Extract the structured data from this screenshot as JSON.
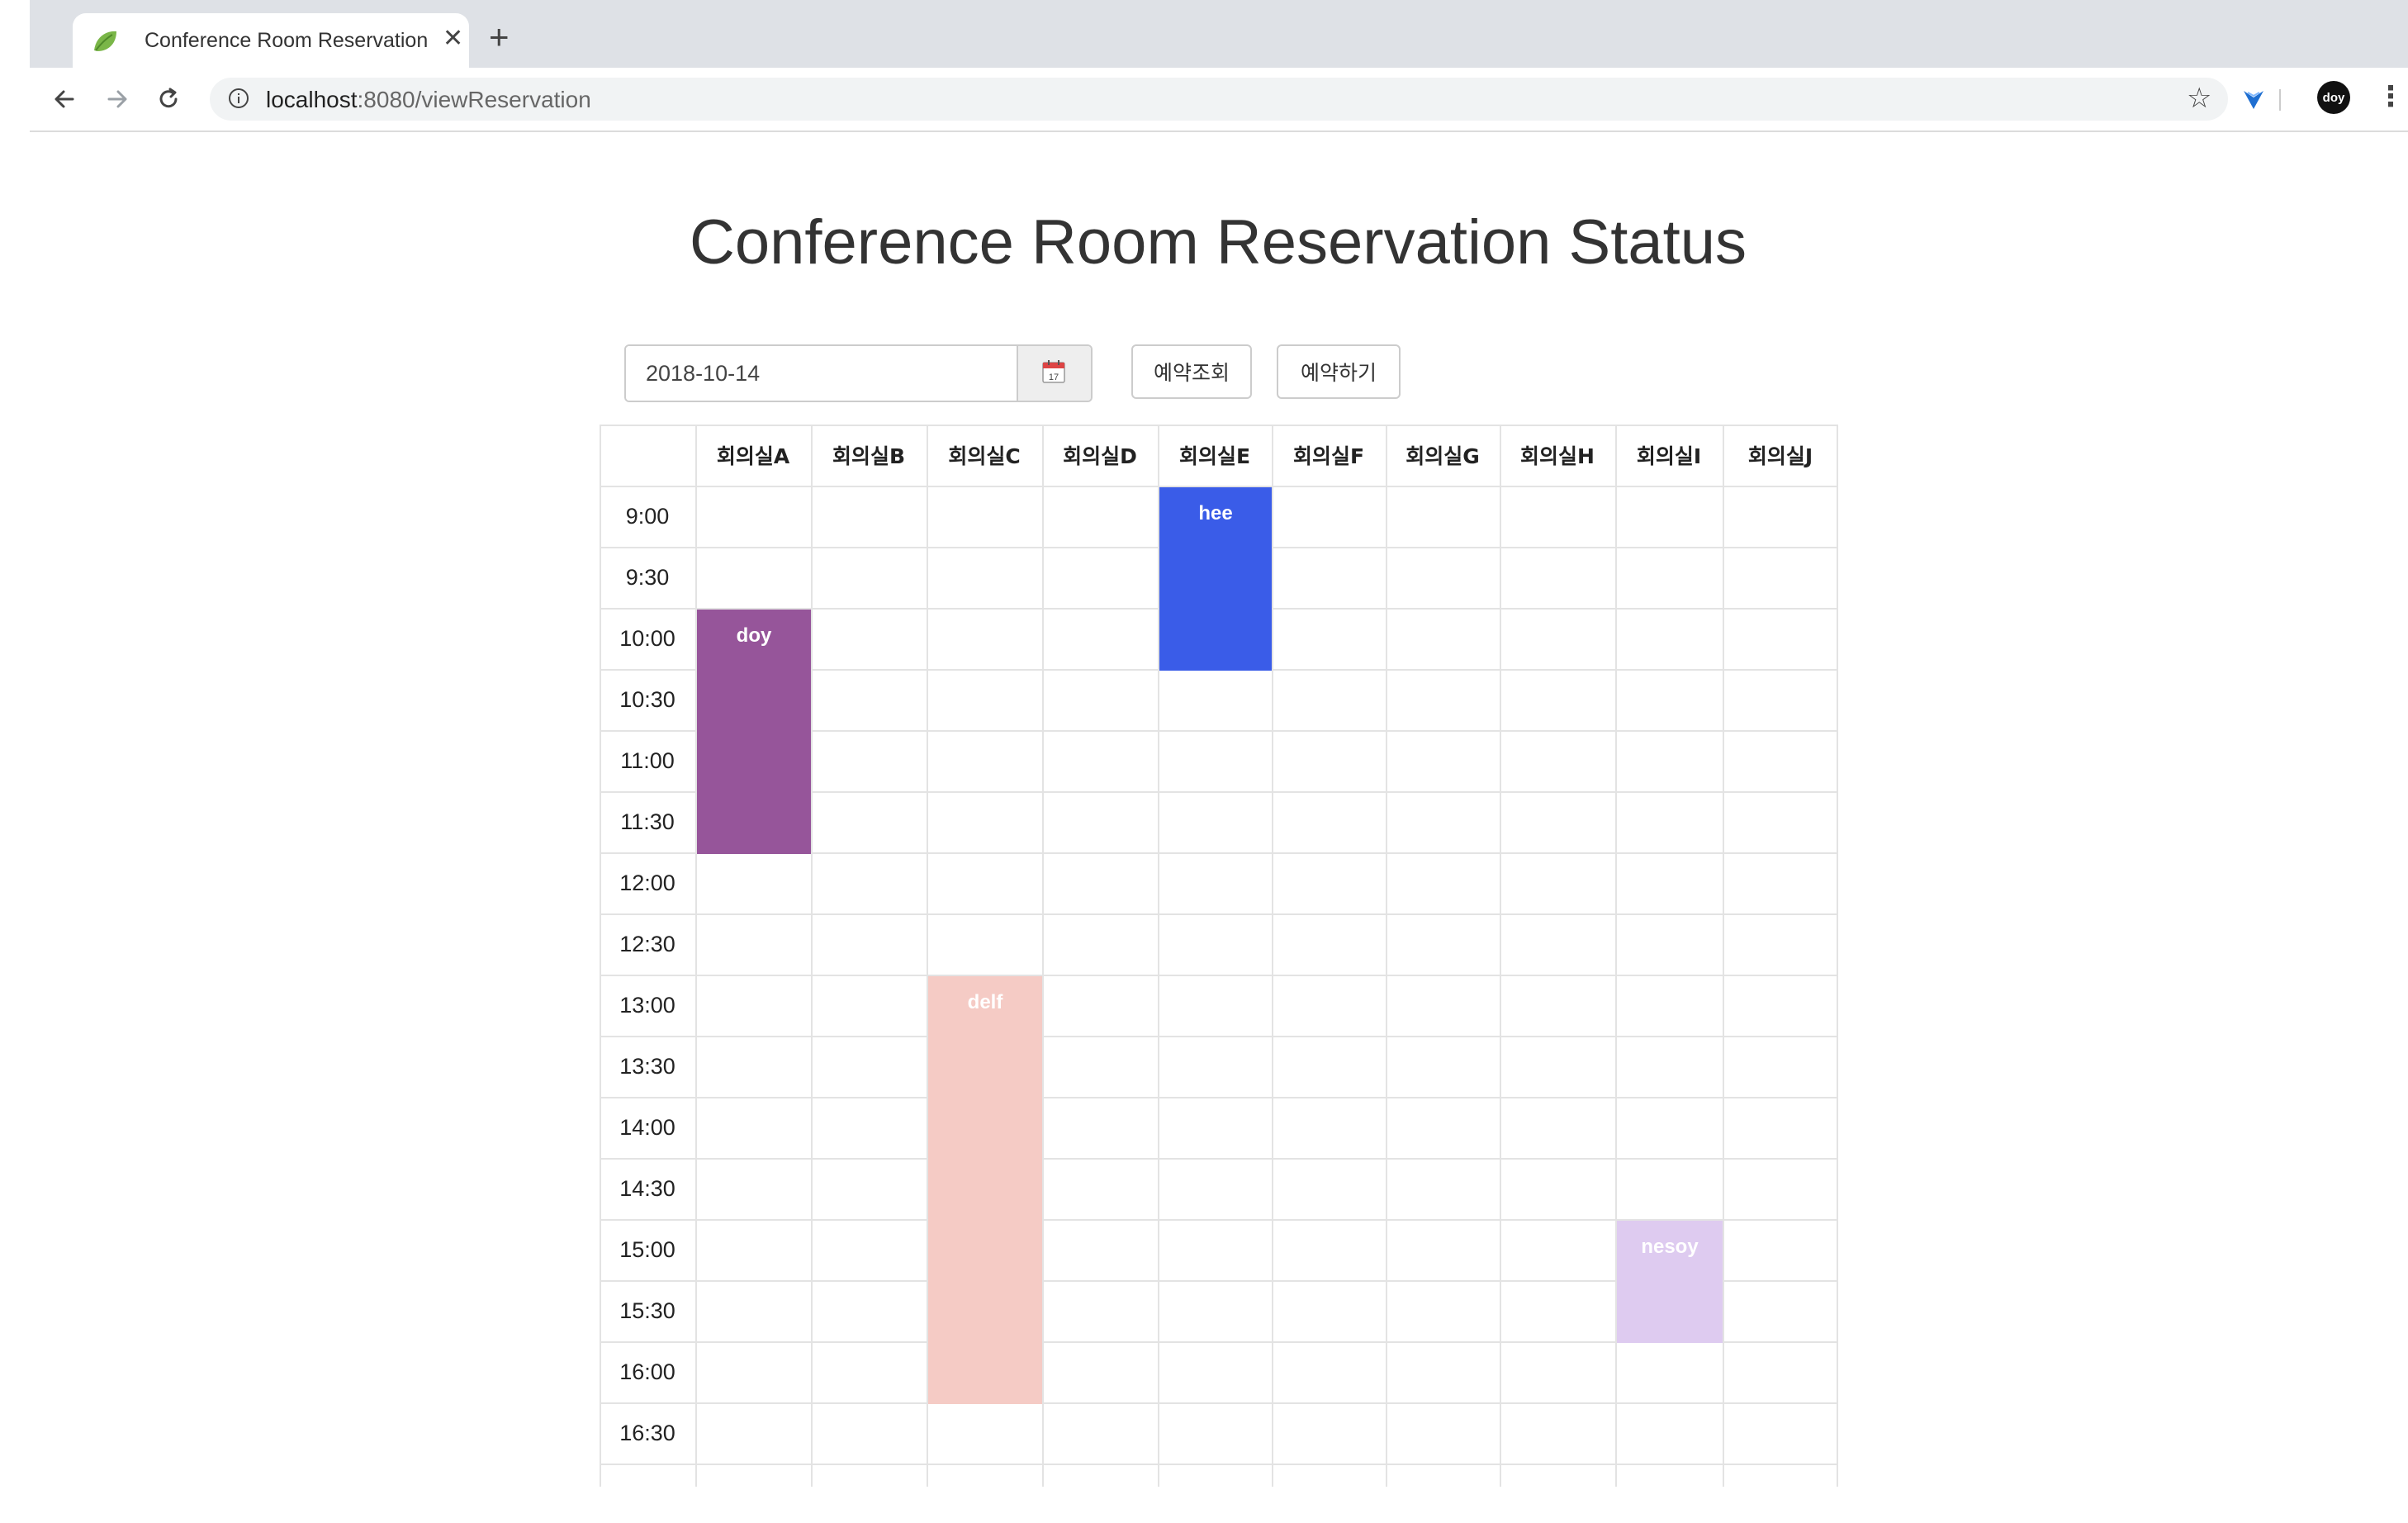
{
  "browser": {
    "tab_title": "Conference Room Reservation",
    "url_host": "localhost",
    "url_rest": ":8080/viewReservation",
    "avatar_text": "doy"
  },
  "page": {
    "title": "Conference Room Reservation Status",
    "date_value": "2018-10-14",
    "search_button": "예약조회",
    "reserve_button": "예약하기"
  },
  "schedule": {
    "rooms": [
      "회의실A",
      "회의실B",
      "회의실C",
      "회의실D",
      "회의실E",
      "회의실F",
      "회의실G",
      "회의실H",
      "회의실I",
      "회의실J"
    ],
    "times": [
      "9:00",
      "9:30",
      "10:00",
      "10:30",
      "11:00",
      "11:30",
      "12:00",
      "12:30",
      "13:00",
      "13:30",
      "14:00",
      "14:30",
      "15:00",
      "15:30",
      "16:00",
      "16:30"
    ],
    "reservations": [
      {
        "room": 4,
        "start": "9:00",
        "end": "10:30",
        "name": "hee",
        "color": "#3a5ce8"
      },
      {
        "room": 0,
        "start": "10:00",
        "end": "12:00",
        "name": "doy",
        "color": "#96559a"
      },
      {
        "room": 2,
        "start": "13:00",
        "end": "16:30",
        "name": "delf",
        "color": "#f5cbc5"
      },
      {
        "room": 8,
        "start": "15:00",
        "end": "16:00",
        "name": "nesoy",
        "color": "#decbf0"
      }
    ]
  },
  "icons": {
    "favicon": "leaf-icon",
    "calendar": "calendar-icon"
  }
}
